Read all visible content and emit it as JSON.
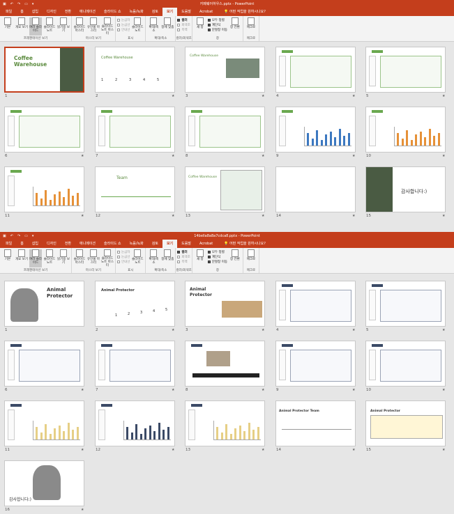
{
  "window1": {
    "title": "카페웨어하우스.pptx - PowerPoint",
    "theme_color": "#c43e1c",
    "menu": [
      "파일",
      "홈",
      "삽입",
      "디자인",
      "전환",
      "애니메이션",
      "슬라이드 쇼",
      "녹음/녹화",
      "검토",
      "보기",
      "도움말",
      "Acrobat"
    ],
    "active_menu": "보기",
    "tell_me": "어떤 작업을 원하시나요?",
    "slides": [
      {
        "n": "1",
        "title": "Coffee Warehouse"
      },
      {
        "n": "2",
        "title": "Coffee Warehouse"
      },
      {
        "n": "3",
        "title": "Coffee Warehouse"
      },
      {
        "n": "4"
      },
      {
        "n": "5"
      },
      {
        "n": "6"
      },
      {
        "n": "7"
      },
      {
        "n": "8"
      },
      {
        "n": "9"
      },
      {
        "n": "10"
      },
      {
        "n": "11"
      },
      {
        "n": "12",
        "title": "Team"
      },
      {
        "n": "13",
        "title": "Coffee Warehouse"
      },
      {
        "n": "14"
      },
      {
        "n": "15",
        "title": "감사합니다:)"
      }
    ]
  },
  "window2": {
    "title": "14bella8a8a7cdca8.pptx - PowerPoint",
    "theme_color": "#c43e1c",
    "menu": [
      "파일",
      "홈",
      "삽입",
      "디자인",
      "전환",
      "애니메이션",
      "슬라이드 쇼",
      "녹음/녹화",
      "검토",
      "보기",
      "도움말",
      "Acrobat"
    ],
    "active_menu": "보기",
    "tell_me": "어떤 작업을 원하시나요?",
    "slides": [
      {
        "n": "1",
        "title": "Animal Protector"
      },
      {
        "n": "2",
        "title": "Animal Protector"
      },
      {
        "n": "3",
        "title": "Animal Protector"
      },
      {
        "n": "4"
      },
      {
        "n": "5"
      },
      {
        "n": "6"
      },
      {
        "n": "7"
      },
      {
        "n": "8"
      },
      {
        "n": "9"
      },
      {
        "n": "10"
      },
      {
        "n": "11"
      },
      {
        "n": "12"
      },
      {
        "n": "13"
      },
      {
        "n": "14",
        "title": "Animal Protector Team"
      },
      {
        "n": "15",
        "title": "Animal Protector"
      },
      {
        "n": "16",
        "title": "감사합니다:)"
      }
    ]
  },
  "ribbon": {
    "views": [
      {
        "label": "기본",
        "sel": false
      },
      {
        "label": "개요 보기",
        "sel": false
      },
      {
        "label": "여러 슬라이드",
        "sel": true
      },
      {
        "label": "슬라이드 노트",
        "sel": false
      },
      {
        "label": "읽기용 보기",
        "sel": false
      }
    ],
    "views_group": "프레젠테이션 보기",
    "master": [
      "슬라이드 마스터",
      "유인물 마스터",
      "슬라이드 노트 마스터"
    ],
    "master_group": "마스터 보기",
    "show": [
      "눈금자",
      "눈금선",
      "안내선"
    ],
    "show_group": "표시",
    "notes_btn": "슬라이드 노트",
    "zoom": [
      "확대/축소",
      "창에 맞춤"
    ],
    "zoom_group": "확대/축소",
    "color": [
      "컬러",
      "회색조",
      "흑백"
    ],
    "color_group": "컬러/회색조",
    "window_btns": [
      "새 창",
      "모두 정렬",
      "계단식",
      "분할창 이동",
      "창 전환"
    ],
    "window_group": "창",
    "macro": "매크로",
    "macro_group": "매크로"
  }
}
